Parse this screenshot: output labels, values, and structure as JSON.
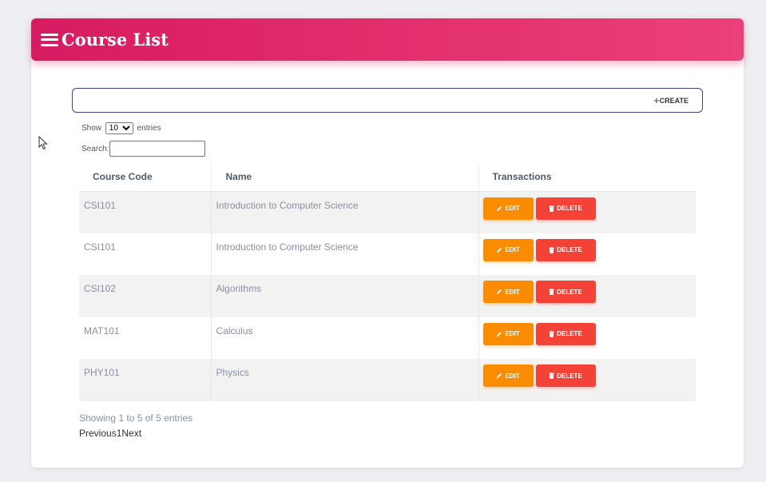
{
  "header": {
    "title": "Course List",
    "menu_icon": "menu-icon"
  },
  "toolbar": {
    "create_label": "CREATE",
    "create_icon": "+"
  },
  "length_menu": {
    "prefix": "Show",
    "selected": "10",
    "suffix": "entries"
  },
  "search": {
    "label": "Search:",
    "value": ""
  },
  "table": {
    "columns": [
      "Course Code",
      "Name",
      "Transactions"
    ],
    "rows": [
      {
        "code": "CSI101",
        "name": "Introduction to Computer Science"
      },
      {
        "code": "CSI101",
        "name": "Introduction to Computer Science"
      },
      {
        "code": "CSI102",
        "name": "Algorithms"
      },
      {
        "code": "MAT101",
        "name": "Calculus"
      },
      {
        "code": "PHY101",
        "name": "Physics"
      }
    ],
    "edit_label": "EDIT",
    "delete_label": "DELETE"
  },
  "info": "Showing 1 to 5 of 5 entries",
  "pagination": {
    "previous": "Previous",
    "current": "1",
    "next": "Next"
  },
  "colors": {
    "header_start": "#d81b60",
    "header_end": "#ec407a",
    "edit": "#fb8c00",
    "delete": "#f44336"
  }
}
